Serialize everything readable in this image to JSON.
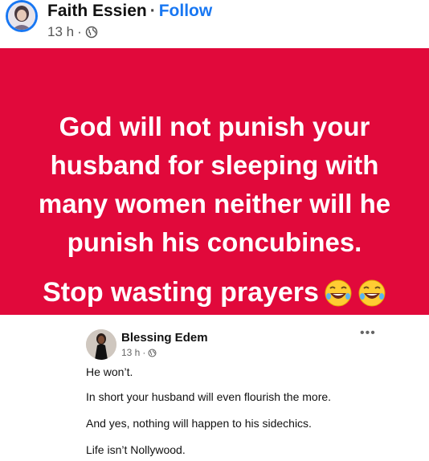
{
  "post": {
    "author": "Faith Essien",
    "separator": "·",
    "follow_label": "Follow",
    "time": "13 h",
    "meta_dot": "·",
    "audience_icon": "globe-icon"
  },
  "card": {
    "background": "#e1093b",
    "quote": "God will not punish your husband for sleeping with many women neither will he punish his concubines.",
    "stop_text": "Stop wasting prayers",
    "emoji": "rolling-on-the-floor-laughing"
  },
  "comment": {
    "name": "Blessing Edem",
    "time": "13 h",
    "meta_dot": "·",
    "more_label": "•••",
    "lines": [
      "He won’t.",
      "In short your husband will even flourish the more.",
      "And yes, nothing will happen to his sidechics.",
      "Life isn’t Nollywood."
    ]
  }
}
